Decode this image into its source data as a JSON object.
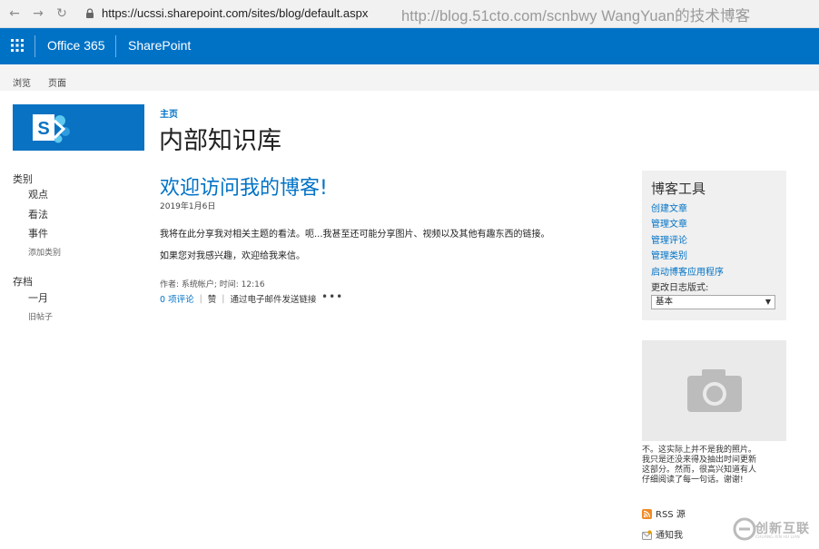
{
  "browser": {
    "back_icon": "arrow-left-icon",
    "forward_icon": "arrow-right-icon",
    "reload_icon": "reload-icon",
    "url": "https://ucssi.sharepoint.com/sites/blog/default.aspx",
    "watermark": "http://blog.51cto.com/scnbwy WangYuan的技术博客"
  },
  "suite_bar": {
    "app_launcher_icon": "waffle-icon",
    "product": "Office 365",
    "app": "SharePoint",
    "color": "#0072c6"
  },
  "ribbon": {
    "tabs": [
      "浏览",
      "页面"
    ]
  },
  "site": {
    "breadcrumb": "主页",
    "title": "内部知识库"
  },
  "left_nav": {
    "categories_heading": "类别",
    "categories": [
      "观点",
      "看法",
      "事件"
    ],
    "add_category": "添加类别",
    "archive_heading": "存档",
    "archive_items": [
      "一月"
    ],
    "old_posts": "旧帖子"
  },
  "post": {
    "title": "欢迎访问我的博客!",
    "date": "2019年1月6日",
    "paragraphs": [
      "我将在此分享我对相关主题的看法。呃...我甚至还可能分享图片、视频以及其他有趣东西的链接。",
      "如果您对我感兴趣，欢迎给我来信。"
    ],
    "meta": "作者: 系统帐户; 时间: 12:16",
    "comments": "0 项评论",
    "like": "赞",
    "email_link": "通过电子邮件发送链接",
    "more": "•••"
  },
  "blog_tools": {
    "title": "博客工具",
    "links": [
      "创建文章",
      "管理文章",
      "管理评论",
      "管理类别",
      "启动博客应用程序"
    ],
    "layout_label": "更改日志版式:",
    "layout_value": "基本"
  },
  "photo": {
    "icon": "camera-icon",
    "caption": "不。这实际上并不是我的照片。我只是还没来得及抽出时间更新这部分。然而，很高兴知道有人仔细阅读了每一句话。谢谢!"
  },
  "feeds": {
    "rss": "RSS 源",
    "notify": "通知我"
  },
  "watermark_logo": {
    "text": "创新互联",
    "sub": "CHUANG XIN HU LIAN"
  }
}
